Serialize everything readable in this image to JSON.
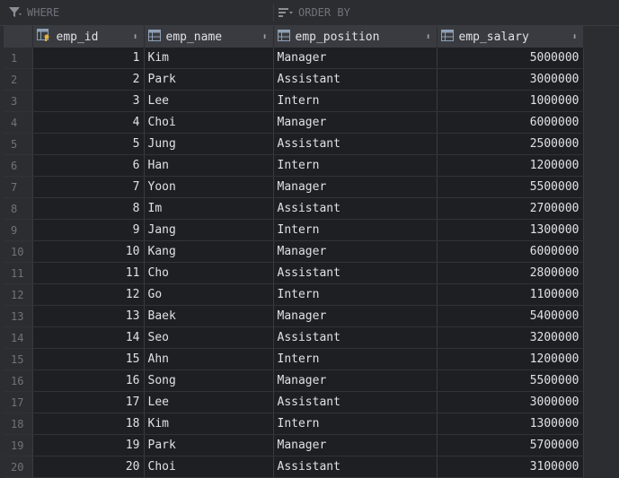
{
  "filter": {
    "where_label": "WHERE",
    "orderby_label": "ORDER BY"
  },
  "columns": [
    {
      "name": "emp_id",
      "icon": "key-column-icon"
    },
    {
      "name": "emp_name",
      "icon": "column-icon"
    },
    {
      "name": "emp_position",
      "icon": "column-icon"
    },
    {
      "name": "emp_salary",
      "icon": "column-icon"
    }
  ],
  "rows": [
    [
      "1",
      "1",
      "Kim",
      "Manager",
      "5000000"
    ],
    [
      "2",
      "2",
      "Park",
      "Assistant",
      "3000000"
    ],
    [
      "3",
      "3",
      "Lee",
      "Intern",
      "1000000"
    ],
    [
      "4",
      "4",
      "Choi",
      "Manager",
      "6000000"
    ],
    [
      "5",
      "5",
      "Jung",
      "Assistant",
      "2500000"
    ],
    [
      "6",
      "6",
      "Han",
      "Intern",
      "1200000"
    ],
    [
      "7",
      "7",
      "Yoon",
      "Manager",
      "5500000"
    ],
    [
      "8",
      "8",
      "Im",
      "Assistant",
      "2700000"
    ],
    [
      "9",
      "9",
      "Jang",
      "Intern",
      "1300000"
    ],
    [
      "10",
      "10",
      "Kang",
      "Manager",
      "6000000"
    ],
    [
      "11",
      "11",
      "Cho",
      "Assistant",
      "2800000"
    ],
    [
      "12",
      "12",
      "Go",
      "Intern",
      "1100000"
    ],
    [
      "13",
      "13",
      "Baek",
      "Manager",
      "5400000"
    ],
    [
      "14",
      "14",
      "Seo",
      "Assistant",
      "3200000"
    ],
    [
      "15",
      "15",
      "Ahn",
      "Intern",
      "1200000"
    ],
    [
      "16",
      "16",
      "Song",
      "Manager",
      "5500000"
    ],
    [
      "17",
      "17",
      "Lee",
      "Assistant",
      "3000000"
    ],
    [
      "18",
      "18",
      "Kim",
      "Intern",
      "1300000"
    ],
    [
      "19",
      "19",
      "Park",
      "Manager",
      "5700000"
    ],
    [
      "20",
      "20",
      "Choi",
      "Assistant",
      "3100000"
    ]
  ]
}
